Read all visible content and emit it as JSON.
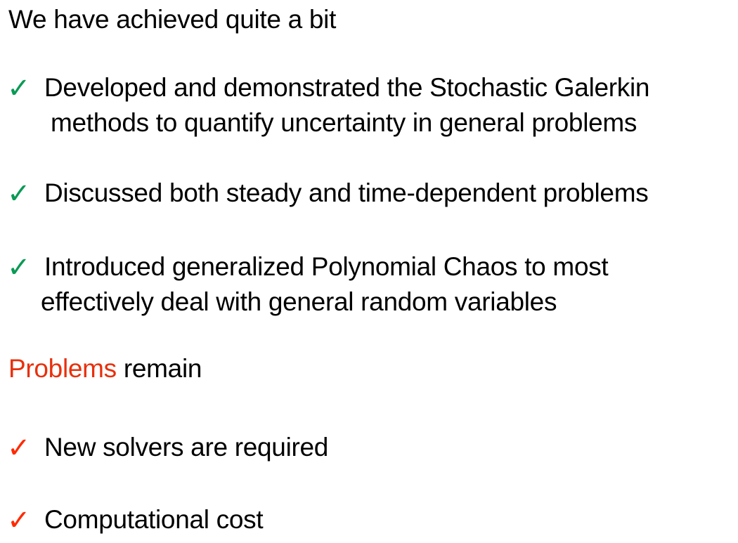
{
  "colors": {
    "check_green": "#0a9a55",
    "check_red": "#ff2a00",
    "accent_red": "#e8300c"
  },
  "icons": {
    "check": "check-mark-icon"
  },
  "check_glyph": "✓",
  "heading1": "We have achieved quite a bit",
  "achievements": [
    {
      "line1": "Developed and demonstrated the Stochastic Galerkin",
      "line2": "methods to quantify uncertainty in general problems"
    },
    {
      "line1": "Discussed both steady and time-dependent problems"
    },
    {
      "line1": "Introduced generalized Polynomial Chaos to most",
      "line2": "effectively deal with general random variables"
    }
  ],
  "heading2": {
    "highlight": "Problems",
    "rest": " remain"
  },
  "problems": [
    {
      "line1": "New solvers are required"
    },
    {
      "line1": "Computational cost"
    }
  ]
}
